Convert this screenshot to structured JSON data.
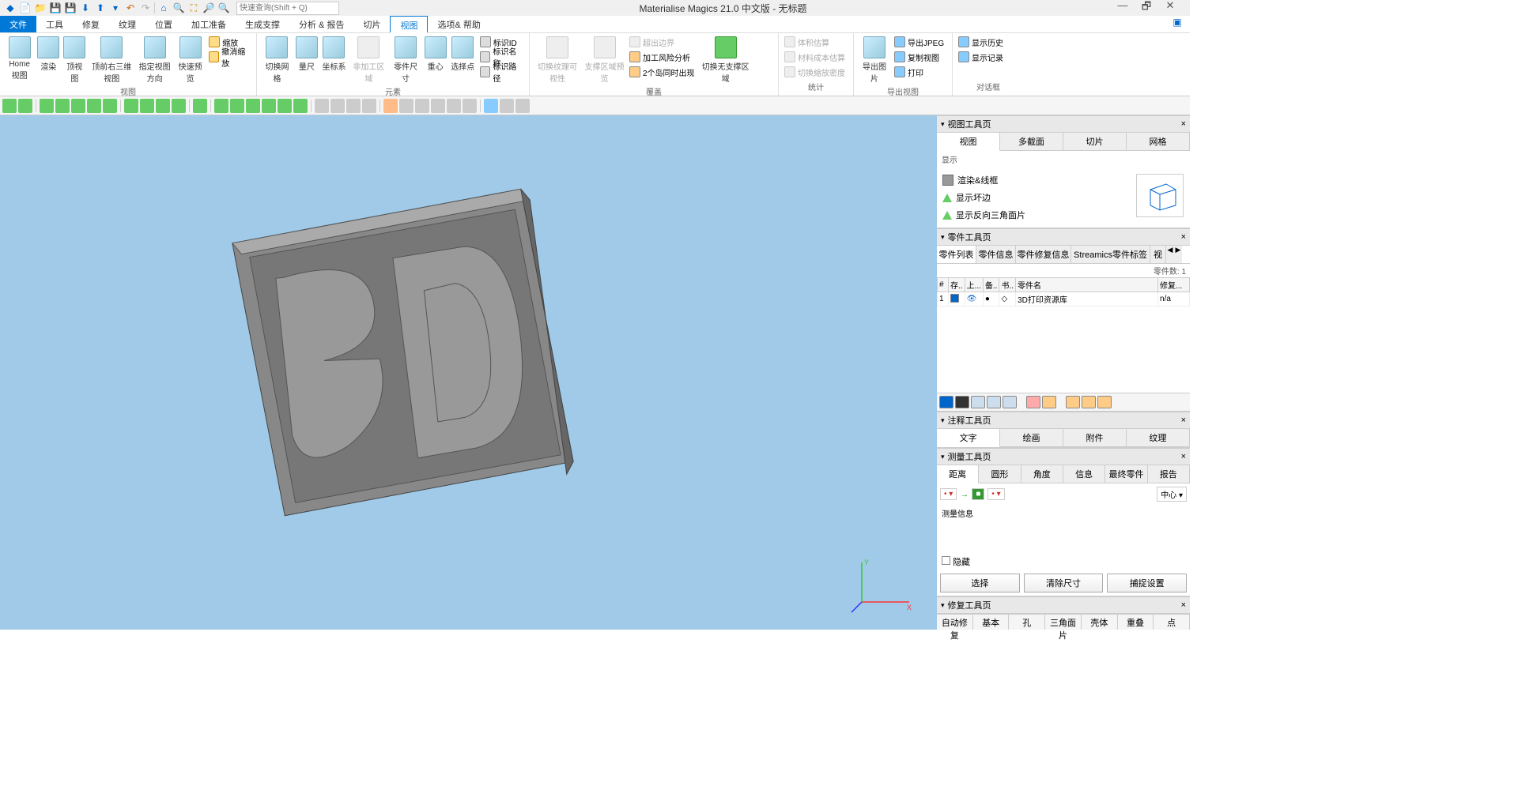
{
  "app": {
    "title": "Materialise Magics 21.0 中文版 - 无标题",
    "search_placeholder": "快速查询(Shift + Q)"
  },
  "menu": {
    "file": "文件",
    "tools": "工具",
    "fix": "修复",
    "texture": "纹理",
    "position": "位置",
    "prep": "加工准备",
    "support": "生成支撑",
    "analyze": "分析 & 报告",
    "slice": "切片",
    "view": "视图",
    "options": "选项& 帮助"
  },
  "ribbon": {
    "groups": {
      "view": "视图",
      "element": "元素",
      "overlay": "覆盖",
      "stats": "统计",
      "export_image": "导出图片",
      "session": "对话框"
    },
    "btns": {
      "home": "Home视图",
      "render": "渲染",
      "top": "顶视图",
      "top_right": "顶前右三维视图",
      "specify": "指定视图方向",
      "fast": "快速预览",
      "zoom": "缩放",
      "undo_zoom": "撤消缩放",
      "toggle_grid": "切换网格",
      "ruler": "量尺",
      "coord": "坐标系",
      "non_build": "非加工区域",
      "part_dim": "零件尺寸",
      "centroid": "重心",
      "sel_point": "选择点",
      "tag_id": "标识ID",
      "tag_name": "标识名称",
      "tag_path": "标识路径",
      "toggle_tex_vis": "切换纹理可视性",
      "sup_preview": "支撑区域预览",
      "out_bounds": "超出边界",
      "risk": "加工风险分析",
      "simultaneous": "2个岛同时出现",
      "toggle_nosup": "切换无支撑区域",
      "vol_est": "体积估算",
      "mat_cost": "材料成本估算",
      "zoom_ratio": "切换缩放密度",
      "exp_jpeg": "导出JPEG",
      "copy_view": "复制视图",
      "print": "打印",
      "exp_view": "导出视图",
      "history": "显示历史",
      "log": "显示记录"
    }
  },
  "panels": {
    "view_tools": {
      "title": "视图工具页",
      "tabs": {
        "view": "视图",
        "section": "多截面",
        "slice": "切片",
        "mesh": "网格"
      },
      "display_label": "显示",
      "opt_render": "渲染&线框",
      "opt_bad_edges": "显示坏边",
      "opt_flipped": "显示反向三角面片"
    },
    "parts_tools": {
      "title": "零件工具页",
      "tabs": {
        "list": "零件列表",
        "info": "零件信息",
        "fix": "零件修复信息",
        "streamics": "Streamics零件标签",
        "view": "视"
      },
      "count_label": "零件数:",
      "count": "1",
      "cols": {
        "num": "#",
        "s": "存..",
        "u": "上...",
        "f": "备..",
        "w": "书..",
        "name": "零件名",
        "fix": "修复..."
      },
      "row": {
        "num": "1",
        "name": "3D打印资源库",
        "fix": "n/a"
      }
    },
    "annot": {
      "title": "注释工具页",
      "tabs": {
        "text": "文字",
        "draw": "绘画",
        "attach": "附件",
        "texture": "纹理"
      }
    },
    "measure": {
      "title": "测量工具页",
      "tabs": {
        "dist": "距离",
        "circle": "圆形",
        "angle": "角度",
        "info": "信息",
        "final": "最终零件",
        "report": "报告"
      },
      "info": "测量信息",
      "center": "中心",
      "hide": "隐藏",
      "select": "选择",
      "clear": "清除尺寸",
      "snap": "捕捉设置"
    },
    "fix": {
      "title": "修复工具页",
      "tabs": {
        "auto": "自动修复",
        "basic": "基本",
        "hole": "孔",
        "tri": "三角面片",
        "shell": "壳体",
        "overlap": "重叠",
        "point": "点"
      }
    }
  }
}
